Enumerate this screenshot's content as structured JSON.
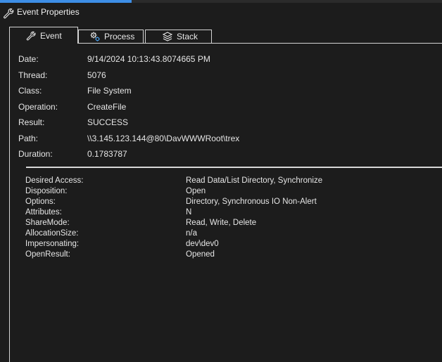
{
  "window": {
    "title": "Event Properties",
    "title_icon": "wrench-icon"
  },
  "tabs": [
    {
      "label": "Event",
      "icon": "wrench-icon",
      "active": true
    },
    {
      "label": "Process",
      "icon": "gear-process-icon",
      "active": false
    },
    {
      "label": "Stack",
      "icon": "stack-layers-icon",
      "active": false
    }
  ],
  "properties": [
    {
      "label": "Date:",
      "value": "9/14/2024 10:13:43.8074665 PM"
    },
    {
      "label": "Thread:",
      "value": "5076"
    },
    {
      "label": "Class:",
      "value": "File System"
    },
    {
      "label": "Operation:",
      "value": "CreateFile"
    },
    {
      "label": "Result:",
      "value": "SUCCESS"
    },
    {
      "label": "Path:",
      "value": "\\\\3.145.123.144@80\\DavWWWRoot\\trex"
    },
    {
      "label": "Duration:",
      "value": "0.1783787"
    }
  ],
  "details": [
    {
      "label": "Desired Access:",
      "value": "Read Data/List Directory, Synchronize"
    },
    {
      "label": "Disposition:",
      "value": "Open"
    },
    {
      "label": "Options:",
      "value": "Directory, Synchronous IO Non-Alert"
    },
    {
      "label": "Attributes:",
      "value": "N"
    },
    {
      "label": "ShareMode:",
      "value": "Read, Write, Delete"
    },
    {
      "label": "AllocationSize:",
      "value": "n/a"
    },
    {
      "label": "Impersonating:",
      "value": "dev\\dev0"
    },
    {
      "label": "OpenResult:",
      "value": "Opened"
    }
  ],
  "colors": {
    "background": "#1c1c1c",
    "text": "#e6e6e6",
    "border": "#d4d4d4",
    "accent": "#3d8ee6"
  }
}
